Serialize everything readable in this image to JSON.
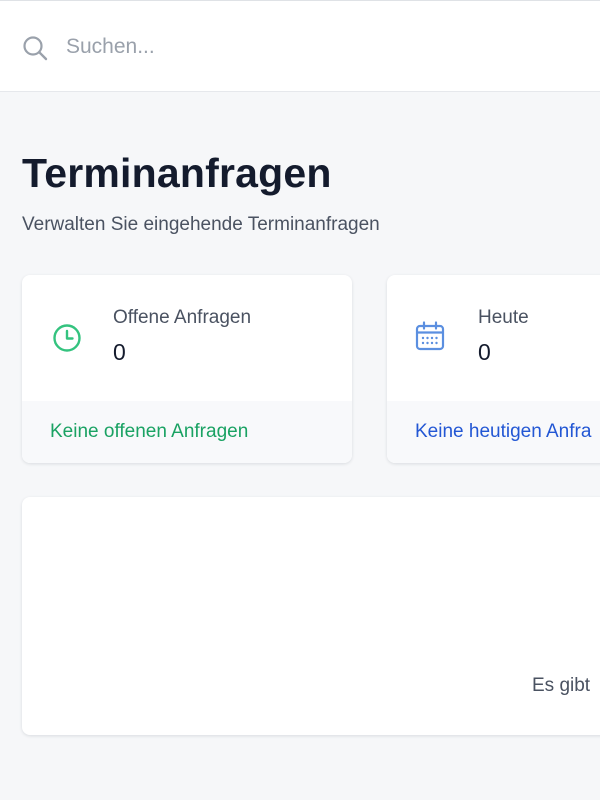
{
  "search": {
    "placeholder": "Suchen...",
    "icon": "search-icon"
  },
  "header": {
    "title": "Terminanfragen",
    "subtitle": "Verwalten Sie eingehende Terminanfragen"
  },
  "cards": [
    {
      "icon": "clock-icon",
      "label": "Offene Anfragen",
      "value": "0",
      "footer": "Keine offenen Anfragen",
      "accent": "#1aa263",
      "icon_color": "#34c37f"
    },
    {
      "icon": "calendar-icon",
      "label": "Heute",
      "value": "0",
      "footer": "Keine heutigen Anfra",
      "accent": "#2357d4",
      "icon_color": "#5b8fe0"
    }
  ],
  "panel": {
    "message": "Es gibt"
  }
}
